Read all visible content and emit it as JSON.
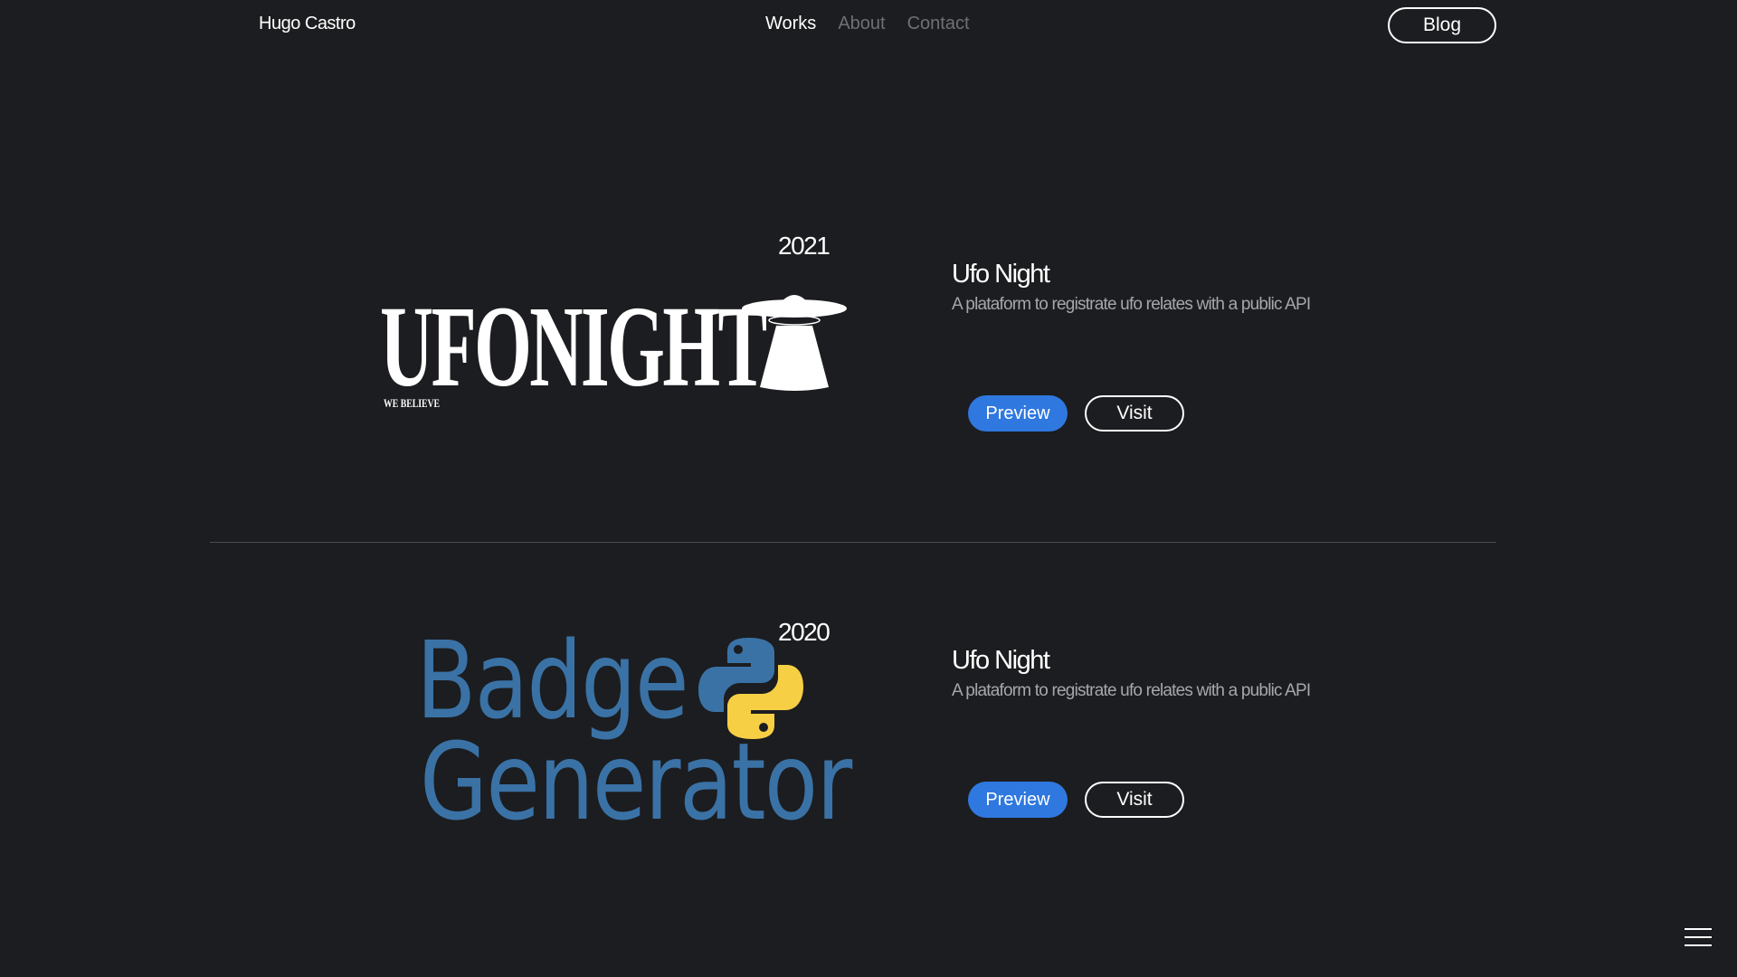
{
  "header": {
    "brand": "Hugo Castro",
    "nav": [
      {
        "label": "Works",
        "active": true
      },
      {
        "label": "About",
        "active": false
      },
      {
        "label": "Contact",
        "active": false
      }
    ],
    "blog_label": "Blog"
  },
  "projects": [
    {
      "year": "2021",
      "title": "Ufo Night",
      "description": "A plataform to registrate ufo relates with a public API",
      "preview_label": "Preview",
      "visit_label": "Visit",
      "logo": {
        "word": "UFONIGHT",
        "tagline": "WE BELIEVE",
        "icon": "ufo-icon"
      }
    },
    {
      "year": "2020",
      "title": "Ufo Night",
      "description": "A plataform to registrate ufo relates with a public API",
      "preview_label": "Preview",
      "visit_label": "Visit",
      "logo": {
        "line1": "Badge",
        "line2": "Generator",
        "icon": "python-icon"
      }
    }
  ],
  "colors": {
    "background": "#1c1d20",
    "accent": "#2f78e0",
    "badge_blue": "#3a72a6",
    "muted_text": "#a6a7ab",
    "nav_inactive": "#6f7075"
  }
}
